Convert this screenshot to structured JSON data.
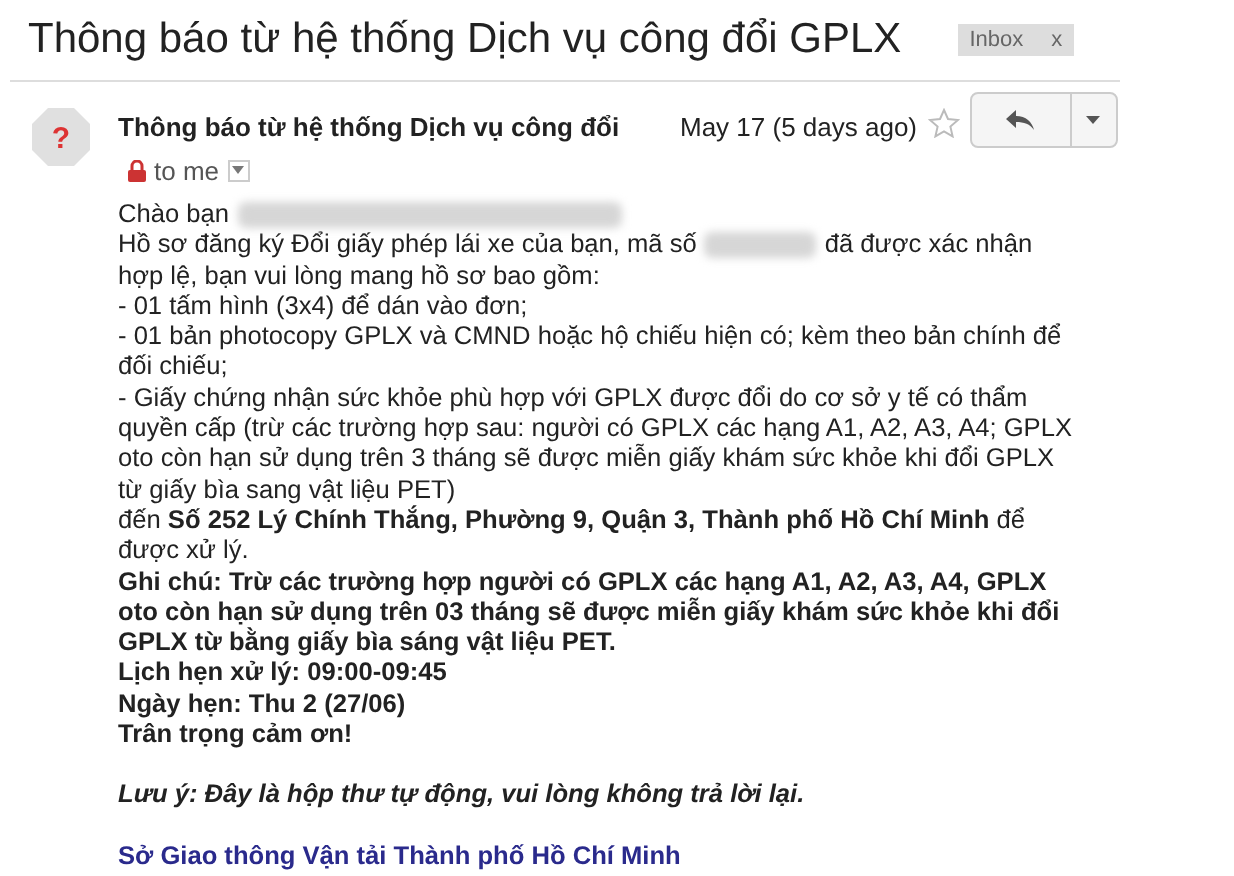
{
  "subject": "Thông báo từ hệ thống Dịch vụ công đổi GPLX",
  "label": {
    "text": "Inbox",
    "close": "x"
  },
  "message": {
    "avatar": "?",
    "sender": "Thông báo từ hệ thống Dịch vụ công đổi",
    "date": "May 17 (5 days ago)",
    "starred": false,
    "recipient": "to me"
  },
  "body": [
    {
      "kind": "plain",
      "parts": [
        {
          "kind": "text",
          "text": "Chào bạn"
        },
        {
          "kind": "redacted_name"
        }
      ]
    },
    {
      "kind": "plain",
      "parts": [
        {
          "kind": "text",
          "text": "Hồ sơ đăng ký Đổi giấy phép lái xe của bạn, mã số"
        },
        {
          "kind": "redacted_code"
        },
        {
          "kind": "text",
          "text": "đã được xác nhận hợp lệ, bạn vui lòng mang hồ sơ bao gồm:"
        }
      ]
    },
    {
      "kind": "plain",
      "parts": [
        {
          "kind": "text",
          "text": "- 01 tấm hình (3x4) để dán vào đơn;"
        }
      ]
    },
    {
      "kind": "plain",
      "parts": [
        {
          "kind": "text",
          "text": "- 01 bản photocopy GPLX và CMND hoặc hộ chiếu hiện có; kèm theo bản chính để đối chiếu;"
        }
      ]
    },
    {
      "kind": "plain",
      "parts": [
        {
          "kind": "text",
          "text": "- Giấy chứng nhận sức khỏe phù hợp với GPLX được đổi do cơ sở y tế có thẩm quyền cấp (trừ các trường hợp sau: người có GPLX các hạng A1, A2, A3, A4; GPLX oto còn hạn sử dụng trên 3 tháng sẽ được miễn giấy khám sức khỏe khi đổi GPLX từ giấy bìa sang vật liệu PET)"
        }
      ]
    },
    {
      "kind": "plain",
      "parts": [
        {
          "kind": "text",
          "text": "đến **Số 252 Lý Chính Thắng, Phường 9, Quận 3, Thành phố Hồ Chí Minh** để được xử lý."
        }
      ]
    },
    {
      "kind": "bold",
      "parts": [
        {
          "kind": "text",
          "text": "Ghi chú: Trừ các trường hợp người có GPLX các hạng A1, A2, A3, A4, GPLX oto còn hạn sử dụng trên 03 tháng sẽ được miễn giấy khám sức khỏe khi đổi GPLX từ bằng giấy bìa sáng vật liệu PET."
        }
      ]
    },
    {
      "kind": "bold",
      "parts": [
        {
          "kind": "text",
          "text": "Lịch hẹn xử lý: 09:00-09:45"
        }
      ]
    },
    {
      "kind": "bold",
      "parts": [
        {
          "kind": "text",
          "text": "Ngày hẹn: Thu 2 (27/06)"
        }
      ]
    },
    {
      "kind": "bold",
      "parts": [
        {
          "kind": "text",
          "text": "Trân trọng cảm ơn!"
        }
      ]
    },
    {
      "kind": "note",
      "parts": [
        {
          "kind": "text",
          "text": "Lưu ý: Đây là hộp thư tự động, vui lòng không trả lời lại."
        }
      ]
    },
    {
      "kind": "signature",
      "parts": [
        {
          "kind": "text",
          "text": "Sở Giao thông Vận tải Thành phố Hồ Chí Minh"
        }
      ]
    }
  ]
}
